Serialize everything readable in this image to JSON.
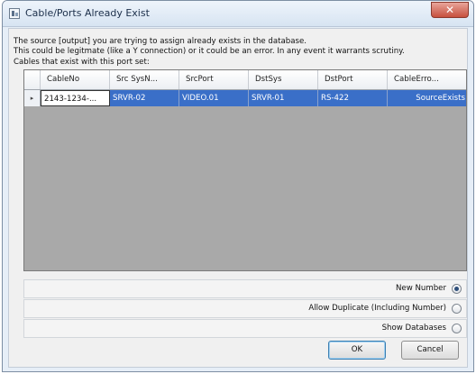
{
  "window": {
    "title": "Cable/Ports Already Exist",
    "close_glyph": "✕",
    "app_icon": "app-icon"
  },
  "message": {
    "line1": "The source [output] you are trying to assign already exists in the database.",
    "line2": "This could be legitmate (like a Y connection) or it could be an error.  In any event it warrants scrutiny."
  },
  "grid": {
    "label": "Cables that exist with this port set:",
    "columns": [
      "CableNo",
      "Src SysN...",
      "SrcPort",
      "DstSys",
      "DstPort",
      "CableErro..."
    ],
    "row_indicator": "▸",
    "rows": [
      [
        "2143-1234-...",
        "SRVR-02",
        "VIDEO.01",
        "SRVR-01",
        "RS-422",
        "SourceExists"
      ]
    ]
  },
  "options": [
    {
      "label": "New Number",
      "selected": true
    },
    {
      "label": "Allow Duplicate (Including Number)",
      "selected": false
    },
    {
      "label": "Show Databases",
      "selected": false
    }
  ],
  "buttons": {
    "ok": "OK",
    "cancel": "Cancel"
  },
  "colors": {
    "selection": "#3a6fc8",
    "close_button": "#c7503e"
  }
}
